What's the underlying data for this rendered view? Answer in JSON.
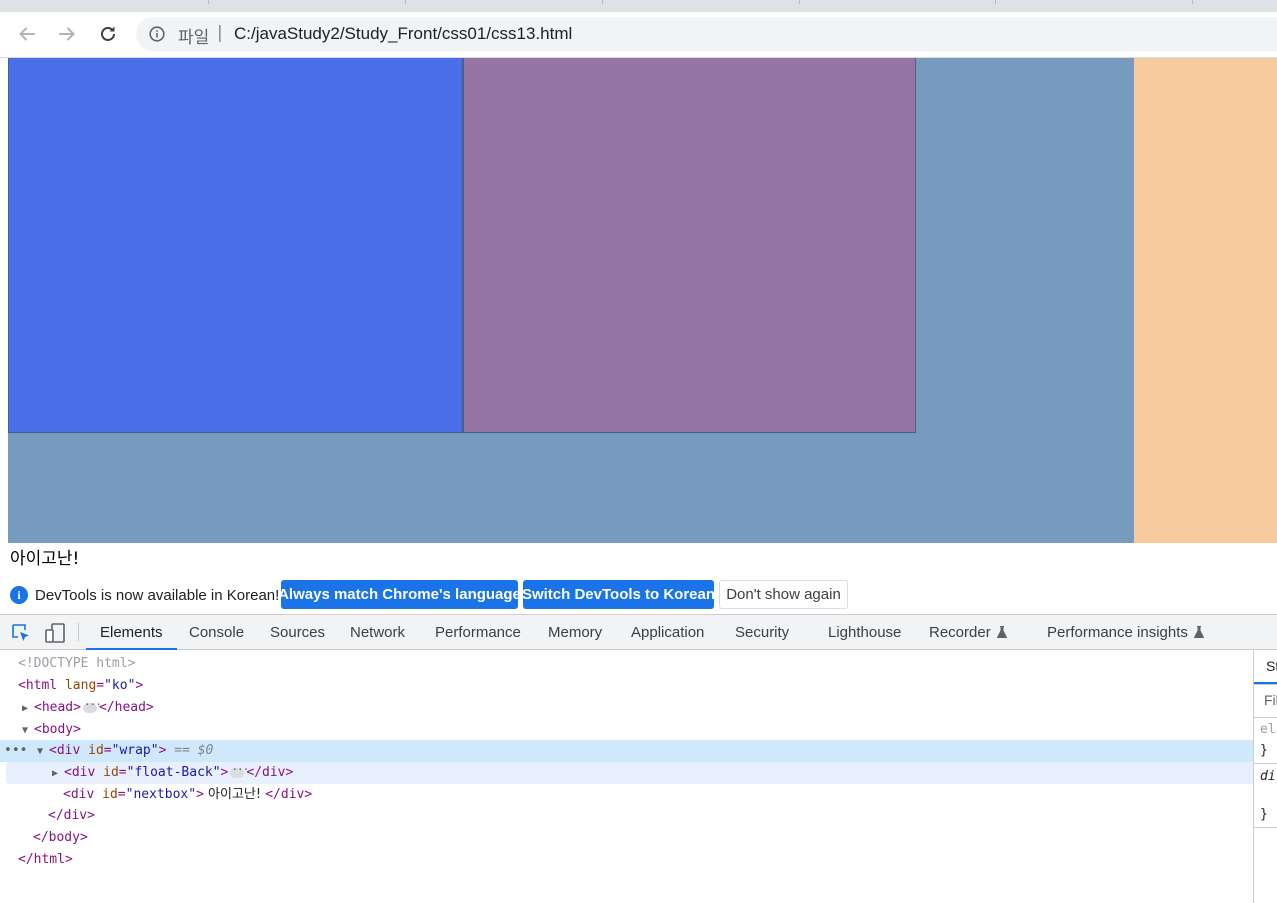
{
  "toolbar": {
    "scheme_label": "파일",
    "url": "C:/javaStudy2/Study_Front/css01/css13.html",
    "back_icon": "back-arrow-icon",
    "forward_icon": "forward-arrow-icon",
    "reload_icon": "reload-icon"
  },
  "page": {
    "nextbox_text": "아이고난!",
    "colors": {
      "wrap": "#779bbf",
      "float_a": "#4a6fe9",
      "float_b": "#9674a5",
      "side": "#f7cb9d"
    }
  },
  "infobar": {
    "message": "DevTools is now available in Korean!",
    "btn_match": "Always match Chrome's language",
    "btn_switch": "Switch DevTools to Korean",
    "btn_dismiss": "Don't show again"
  },
  "devtools": {
    "tabs": [
      "Elements",
      "Console",
      "Sources",
      "Network",
      "Performance",
      "Memory",
      "Application",
      "Security",
      "Lighthouse",
      "Recorder",
      "Performance insights"
    ],
    "active_tab": "Elements",
    "dom": {
      "doctype": "<!DOCTYPE html>",
      "html_open_tag": "<html",
      "html_attr": "lang",
      "html_attr_val": "\"ko\"",
      "head_open": "<head>",
      "head_close": "</head>",
      "body_open": "<body>",
      "div_open": "<div",
      "id_attr": "id",
      "wrap_val": "\"wrap\"",
      "selected_marker": "== $0",
      "float_val": "\"float-Back\"",
      "nextbox_val": "\"nextbox\"",
      "nextbox_text": " 아이고난! ",
      "div_close": "</div>",
      "body_close": "</body>",
      "html_close": "</html>",
      "gt": ">"
    },
    "styles": {
      "tab": "St",
      "filter": "Fil",
      "line1": "el",
      "line2": "}",
      "line3": "di",
      "line4": "}"
    }
  }
}
